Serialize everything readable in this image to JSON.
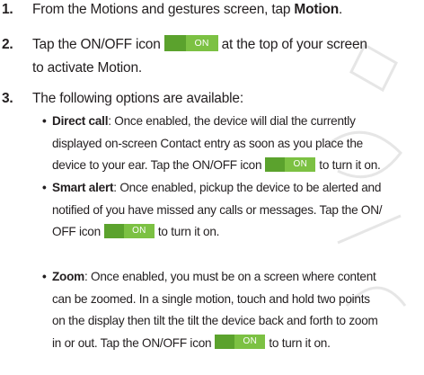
{
  "steps": [
    {
      "num": "1.",
      "before": "From the Motions and gestures screen, tap ",
      "bold": "Motion",
      "after": "."
    },
    {
      "num": "2.",
      "before": "Tap the ON/OFF icon",
      "after": "at the top of your screen",
      "line2": "to activate Motion."
    },
    {
      "num": "3.",
      "text": "The following options are available:"
    }
  ],
  "toggle": {
    "on_label": "ON",
    "off_color": "#5ba22d",
    "on_color": "#7cc143"
  },
  "bullets": [
    {
      "bullet": "•",
      "term": "Direct call",
      "lines": [
        ": Once enabled, the device will dial the currently",
        "displayed on-screen Contact entry as soon as you place the",
        "device to your ear. Tap the ON/OFF icon",
        "to turn it on."
      ]
    },
    {
      "bullet": "•",
      "term": "Smart alert",
      "lines": [
        ": Once enabled, pickup the device to be alerted and",
        "notified of you have missed any calls or messages. Tap the ON/",
        "OFF icon",
        "to turn it on."
      ]
    },
    {
      "bullet": "•",
      "term": "Zoom",
      "lines": [
        ": Once enabled, you must be on a screen where content",
        "can be zoomed. In a single motion, touch and hold two points",
        "on the display then tilt the tilt the device back and forth to zoom",
        "in or out. Tap the ON/OFF icon",
        "to turn it on."
      ]
    }
  ]
}
